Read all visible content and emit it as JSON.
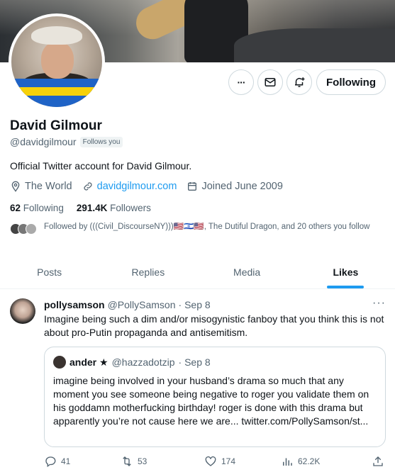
{
  "profile": {
    "name": "David Gilmour",
    "handle": "@davidgilmour",
    "follows_you": "Follows you",
    "bio": "Official Twitter account for David Gilmour.",
    "location": "The World",
    "website": "davidgilmour.com",
    "joined": "Joined June 2009",
    "following_count": "62",
    "following_label": "Following",
    "followers_count": "291.4K",
    "followers_label": "Followers",
    "followed_by": "Followed by (((Civil_DiscourseNY)))🇺🇸🇮🇱🇺🇸, The Dutiful Dragon, and 20 others you follow"
  },
  "actions": {
    "more_label": "···",
    "following_button": "Following"
  },
  "tabs": [
    {
      "label": "Posts"
    },
    {
      "label": "Replies"
    },
    {
      "label": "Media"
    },
    {
      "label": "Likes"
    }
  ],
  "tweet": {
    "author": "pollysamson",
    "handle": "@PollySamson",
    "date": "· Sep 8",
    "text": "Imagine being such a dim and/or misogynistic fanboy that you think this is not about pro-Putin propaganda and antisemitism.",
    "quote": {
      "author": "ander ★",
      "handle": "@hazzadotzip",
      "date": "· Sep 8",
      "text": "imagine being involved in your husband’s drama so much that any moment you see someone being negative to roger you validate them on his goddamn motherfucking birthday! roger is done with this drama but apparently you’re not cause here we are... twitter.com/PollySamson/st..."
    },
    "replies": "41",
    "retweets": "53",
    "likes": "174",
    "views": "62.2K"
  },
  "colors": {
    "accent": "#1d9bf0",
    "text": "#0f1419",
    "muted": "#536471",
    "border": "#cfd9de"
  }
}
